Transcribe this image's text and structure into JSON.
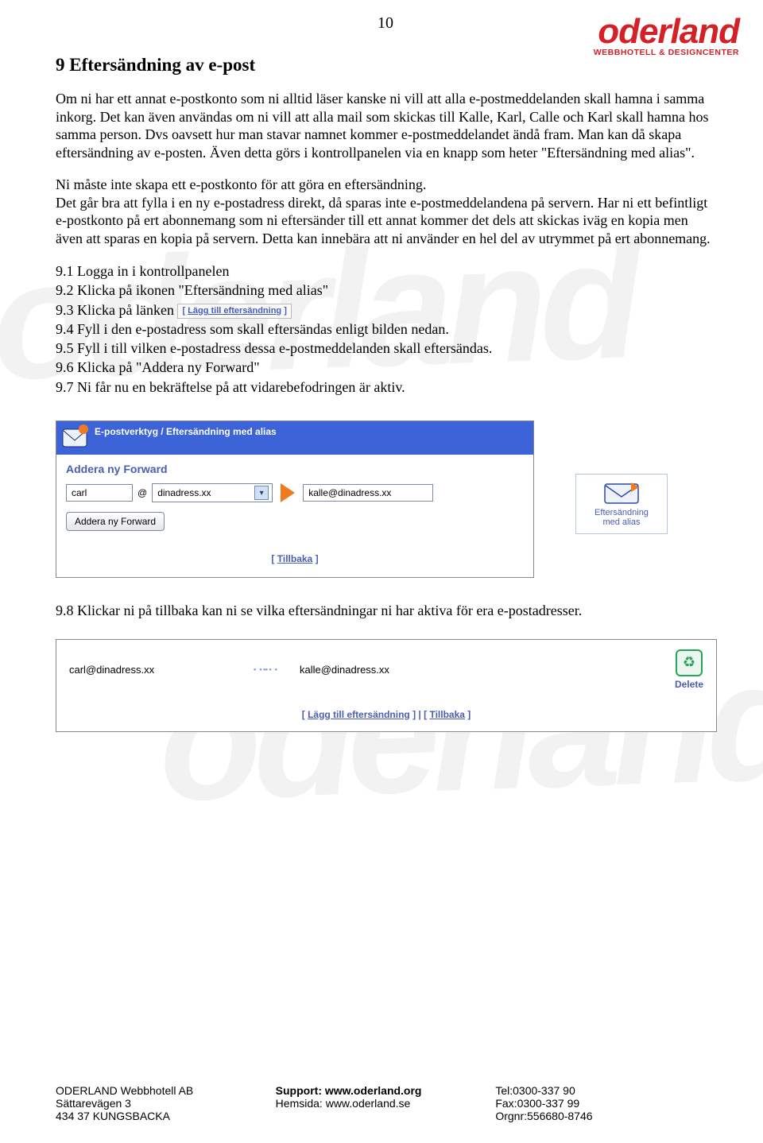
{
  "page_number": "10",
  "logo": {
    "main": "oderland",
    "sub": "WEBBHOTELL & DESIGNCENTER"
  },
  "watermark": "oderland",
  "heading": "9 Eftersändning av e-post",
  "para1": "Om ni har ett annat e-postkonto som ni alltid läser kanske ni vill att alla e-postmeddelanden skall hamna i samma inkorg. Det kan även användas om ni vill att alla mail som skickas till Kalle, Karl, Calle och Karl skall hamna hos samma person. Dvs oavsett hur man stavar namnet kommer e-postmeddelandet ändå fram. Man kan då skapa eftersändning av e-posten. Även detta görs i kontrollpanelen via en knapp som heter \"Eftersändning med alias\".",
  "para2": "Ni måste inte skapa ett e-postkonto för att göra en eftersändning.\nDet går bra att fylla i en ny e-postadress direkt, då sparas inte e-postmeddelandena på servern. Har ni ett befintligt e-postkonto på ert abonnemang som ni eftersänder till ett annat kommer det dels att skickas iväg en kopia men även att sparas en kopia på servern. Detta kan innebära att ni använder en hel del av utrymmet på ert abonnemang.",
  "steps": [
    "9.1 Logga in i kontrollpanelen",
    "9.2 Klicka på ikonen \"Eftersändning med alias\"",
    "9.3 Klicka på länken",
    "9.4 Fyll i den e-postadress som skall eftersändas enligt bilden nedan.",
    "9.5 Fyll i till vilken e-postadress dessa e-postmeddelanden skall eftersändas.",
    "9.6 Klicka på \"Addera ny Forward\"",
    "9.7 Ni får nu en bekräftelse på att vidarebefodringen är aktiv."
  ],
  "inline_link": {
    "label": "Lägg till eftersändning",
    "brackets": "[  ]"
  },
  "side_icon": {
    "line1": "Eftersändning",
    "line2": "med alias"
  },
  "form": {
    "titlebar": "E-postverktyg / Eftersändning med alias",
    "subtitle": "Addera ny Forward",
    "user_value": "carl",
    "at": "@",
    "domain_value": "dinadress.xx",
    "dest_value": "kalle@dinadress.xx",
    "button": "Addera ny Forward",
    "back": "Tillbaka"
  },
  "step8": "9.8 Klickar ni på tillbaka kan ni se vilka eftersändningar ni har aktiva för era e-postadresser.",
  "list_panel": {
    "from": "carl@dinadress.xx",
    "to": "kalle@dinadress.xx",
    "delete": "Delete",
    "link1": "Lägg till eftersändning",
    "link2": "Tillbaka",
    "sep": " | "
  },
  "footer": {
    "c1": [
      "ODERLAND Webbhotell AB",
      "Sättarevägen 3",
      "434 37 KUNGSBACKA"
    ],
    "c2l": [
      "Support:",
      "Hemsida:"
    ],
    "c2v": [
      "www.oderland.org",
      "www.oderland.se"
    ],
    "c3": [
      "Tel:0300-337 90",
      "Fax:0300-337 99",
      "Orgnr:556680-8746"
    ]
  }
}
